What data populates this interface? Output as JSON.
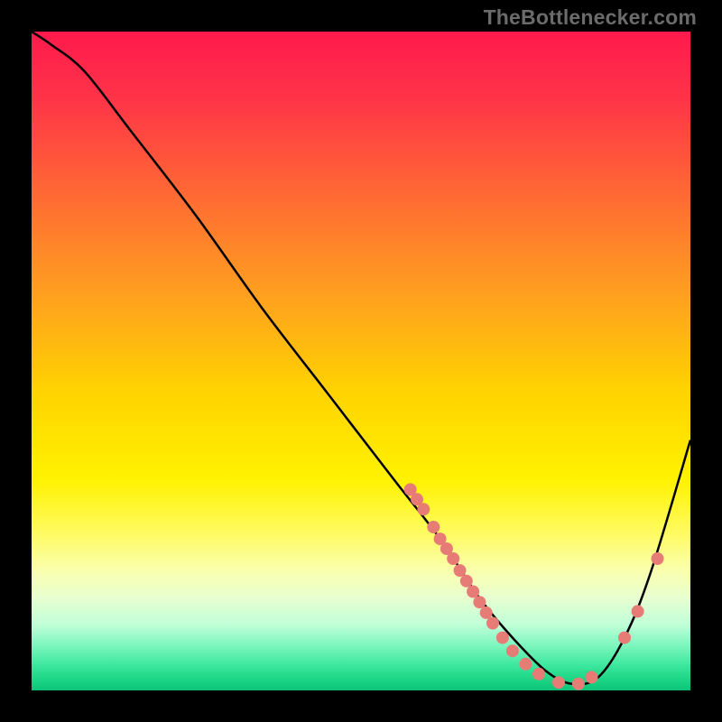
{
  "watermark": "TheBottlenecker.com",
  "chart_data": {
    "type": "line",
    "title": "",
    "xlabel": "",
    "ylabel": "",
    "xlim": [
      0,
      100
    ],
    "ylim": [
      0,
      100
    ],
    "series": [
      {
        "name": "curve",
        "color": "#000000",
        "x": [
          0,
          3,
          8,
          15,
          25,
          35,
          45,
          55,
          62,
          68,
          73,
          78,
          82,
          86,
          90,
          94,
          100
        ],
        "y": [
          100,
          98,
          94,
          85,
          72,
          58,
          45,
          32,
          23,
          14,
          8,
          3,
          1,
          2,
          8,
          18,
          38
        ]
      }
    ],
    "highlight_points": {
      "color": "#e77b76",
      "coords": [
        [
          57.5,
          30.5
        ],
        [
          58.5,
          29.0
        ],
        [
          59.5,
          27.5
        ],
        [
          61.0,
          24.8
        ],
        [
          62.0,
          23.0
        ],
        [
          63.0,
          21.5
        ],
        [
          64.0,
          20.0
        ],
        [
          65.0,
          18.2
        ],
        [
          66.0,
          16.6
        ],
        [
          67.0,
          15.0
        ],
        [
          68.0,
          13.4
        ],
        [
          69.0,
          11.8
        ],
        [
          70.0,
          10.2
        ],
        [
          71.5,
          8.0
        ],
        [
          73.0,
          6.0
        ],
        [
          75.0,
          4.0
        ],
        [
          77.0,
          2.5
        ],
        [
          80.0,
          1.2
        ],
        [
          83.0,
          1.0
        ],
        [
          85.0,
          2.0
        ],
        [
          90.0,
          8.0
        ],
        [
          92.0,
          12.0
        ],
        [
          95.0,
          20.0
        ]
      ]
    },
    "background": {
      "type": "vertical-gradient",
      "stops": [
        [
          0.0,
          "#ff1a4d"
        ],
        [
          0.1,
          "#ff3348"
        ],
        [
          0.25,
          "#ff6a33"
        ],
        [
          0.4,
          "#ffa01f"
        ],
        [
          0.55,
          "#ffd400"
        ],
        [
          0.68,
          "#fff200"
        ],
        [
          0.76,
          "#fffb60"
        ],
        [
          0.82,
          "#faffb0"
        ],
        [
          0.86,
          "#e7ffd0"
        ],
        [
          0.9,
          "#c0ffd8"
        ],
        [
          0.93,
          "#80f7c0"
        ],
        [
          0.96,
          "#40e8a0"
        ],
        [
          0.98,
          "#20d888"
        ],
        [
          1.0,
          "#0cc477"
        ]
      ]
    }
  }
}
